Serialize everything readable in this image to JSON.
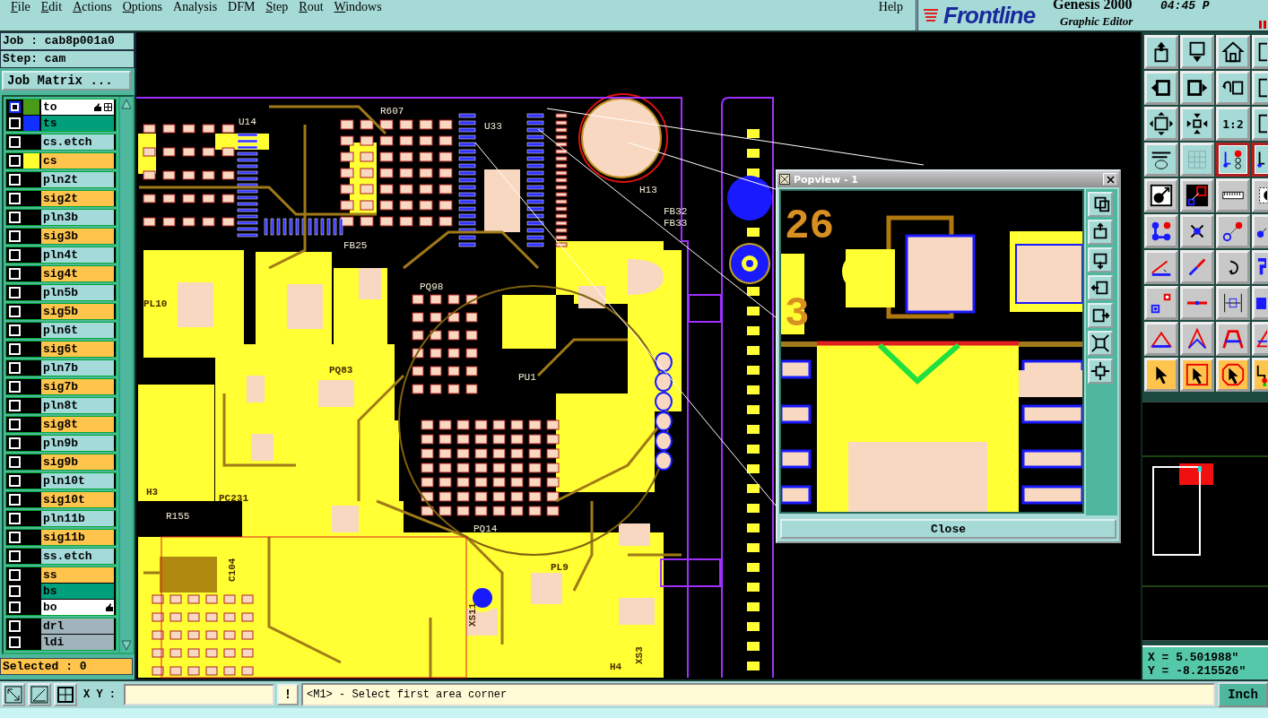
{
  "menu": {
    "items": [
      {
        "label": "File",
        "mnemonic": true
      },
      {
        "label": "Edit",
        "mnemonic": true
      },
      {
        "label": "Actions",
        "mnemonic": true
      },
      {
        "label": "Options",
        "mnemonic": true
      },
      {
        "label": "Analysis",
        "mnemonic": false
      },
      {
        "label": "DFM",
        "mnemonic": false
      },
      {
        "label": "Step",
        "mnemonic": true
      },
      {
        "label": "Rout",
        "mnemonic": true
      },
      {
        "label": "Windows",
        "mnemonic": true
      }
    ],
    "help": "Help"
  },
  "brand": {
    "logo": "Frontline",
    "product": "Genesis 2000",
    "subtitle": "Graphic Editor",
    "time": "04:45 P"
  },
  "job": {
    "job": "Job : cab8p001a0",
    "step": "Step: cam",
    "matrix_button": "Job Matrix ..."
  },
  "layer_groups": [
    {
      "layers": [
        {
          "name": "to",
          "kind": "overlay",
          "color": "#4a9a18",
          "selected": true,
          "affected": true
        },
        {
          "name": "ts",
          "kind": "mask",
          "color": "#1030ff",
          "selected": false,
          "affected": false
        }
      ]
    },
    {
      "layers": [
        {
          "name": "cs.etch",
          "kind": "plane",
          "selected": false,
          "affected": false
        }
      ]
    },
    {
      "layers": [
        {
          "name": "cs",
          "kind": "signal",
          "color": "#ffff30",
          "selected": false,
          "affected": false
        }
      ]
    },
    {
      "layers": [
        {
          "name": "pln2t",
          "kind": "plane",
          "selected": false,
          "affected": false
        }
      ]
    },
    {
      "layers": [
        {
          "name": "sig2t",
          "kind": "signal",
          "selected": false,
          "affected": false
        }
      ]
    },
    {
      "layers": [
        {
          "name": "pln3b",
          "kind": "plane",
          "selected": false,
          "affected": false
        }
      ]
    },
    {
      "layers": [
        {
          "name": "sig3b",
          "kind": "signal",
          "selected": false,
          "affected": false
        }
      ]
    },
    {
      "layers": [
        {
          "name": "pln4t",
          "kind": "plane",
          "selected": false,
          "affected": false
        }
      ]
    },
    {
      "layers": [
        {
          "name": "sig4t",
          "kind": "signal",
          "selected": false,
          "affected": false
        }
      ]
    },
    {
      "layers": [
        {
          "name": "pln5b",
          "kind": "plane",
          "selected": false,
          "affected": false
        }
      ]
    },
    {
      "layers": [
        {
          "name": "sig5b",
          "kind": "signal",
          "selected": false,
          "affected": false
        }
      ]
    },
    {
      "layers": [
        {
          "name": "pln6t",
          "kind": "plane",
          "selected": false,
          "affected": false
        }
      ]
    },
    {
      "layers": [
        {
          "name": "sig6t",
          "kind": "signal",
          "selected": false,
          "affected": false
        }
      ]
    },
    {
      "layers": [
        {
          "name": "pln7b",
          "kind": "plane",
          "selected": false,
          "affected": false
        }
      ]
    },
    {
      "layers": [
        {
          "name": "sig7b",
          "kind": "signal",
          "selected": false,
          "affected": false
        }
      ]
    },
    {
      "layers": [
        {
          "name": "pln8t",
          "kind": "plane",
          "selected": false,
          "affected": false
        }
      ]
    },
    {
      "layers": [
        {
          "name": "sig8t",
          "kind": "signal",
          "selected": false,
          "affected": false
        }
      ]
    },
    {
      "layers": [
        {
          "name": "pln9b",
          "kind": "plane",
          "selected": false,
          "affected": false
        }
      ]
    },
    {
      "layers": [
        {
          "name": "sig9b",
          "kind": "signal",
          "selected": false,
          "affected": false
        }
      ]
    },
    {
      "layers": [
        {
          "name": "pln10t",
          "kind": "plane",
          "selected": false,
          "affected": false
        }
      ]
    },
    {
      "layers": [
        {
          "name": "sig10t",
          "kind": "signal",
          "selected": false,
          "affected": false
        }
      ]
    },
    {
      "layers": [
        {
          "name": "pln11b",
          "kind": "plane",
          "selected": false,
          "affected": false
        }
      ]
    },
    {
      "layers": [
        {
          "name": "sig11b",
          "kind": "signal",
          "selected": false,
          "affected": false
        }
      ]
    },
    {
      "layers": [
        {
          "name": "ss.etch",
          "kind": "plane",
          "selected": false,
          "affected": false
        }
      ]
    },
    {
      "layers": [
        {
          "name": "ss",
          "kind": "signal",
          "selected": false,
          "affected": false
        },
        {
          "name": "bs",
          "kind": "mask",
          "selected": false,
          "affected": false
        },
        {
          "name": "bo",
          "kind": "overlay",
          "selected": false,
          "affected": true
        }
      ]
    },
    {
      "layers": [
        {
          "name": "drl",
          "kind": "drill",
          "selected": false,
          "affected": false
        },
        {
          "name": "ldi",
          "kind": "drill",
          "selected": false,
          "affected": false
        }
      ]
    }
  ],
  "selected_count": "Selected : 0",
  "board_labels": [
    "U14",
    "R607",
    "U33",
    "H13",
    "FB32",
    "FB33",
    "FB25",
    "PL10",
    "PQ98",
    "PQ83",
    "PU1",
    "PC231",
    "H3",
    "R155",
    "C104",
    "PQ14",
    "PL9",
    "XS11",
    "H4",
    "XS3"
  ],
  "popview": {
    "title": "Popview - 1",
    "labels": [
      "26",
      "3"
    ],
    "close": "Close"
  },
  "toolbar": {
    "rows": [
      {
        "kind": "view",
        "buttons": [
          {
            "selected": false
          },
          {
            "selected": false
          },
          {
            "selected": false
          },
          {
            "selected": false
          }
        ]
      },
      {
        "kind": "view",
        "buttons": [
          {
            "selected": false
          },
          {
            "selected": false
          },
          {
            "selected": false
          },
          {
            "selected": false
          }
        ]
      },
      {
        "kind": "view",
        "buttons": [
          {
            "selected": false
          },
          {
            "selected": false
          },
          {
            "selected": false,
            "label": "1:2"
          },
          {
            "selected": false
          }
        ]
      },
      {
        "kind": "view",
        "buttons": [
          {
            "selected": false
          },
          {
            "selected": false
          },
          {
            "selected": true
          },
          {
            "selected": true
          }
        ]
      },
      {
        "kind": "measure",
        "buttons": [
          {
            "selected": false
          },
          {
            "selected": false
          },
          {
            "selected": false
          },
          {
            "selected": false
          }
        ]
      },
      {
        "kind": "edit",
        "buttons": [
          {
            "selected": false
          },
          {
            "selected": false
          },
          {
            "selected": false
          },
          {
            "selected": false
          }
        ]
      },
      {
        "kind": "edit",
        "buttons": [
          {
            "selected": false
          },
          {
            "selected": false
          },
          {
            "selected": false
          },
          {
            "selected": false
          }
        ]
      },
      {
        "kind": "edit",
        "buttons": [
          {
            "selected": false
          },
          {
            "selected": false
          },
          {
            "selected": false
          },
          {
            "selected": false
          }
        ]
      },
      {
        "kind": "edit",
        "buttons": [
          {
            "selected": false
          },
          {
            "selected": false
          },
          {
            "selected": false
          },
          {
            "selected": false
          }
        ]
      },
      {
        "kind": "select",
        "buttons": [
          {
            "selected": false
          },
          {
            "selected": false
          },
          {
            "selected": false
          },
          {
            "selected": false
          }
        ]
      }
    ]
  },
  "coordinates": [
    "X = 5.501988\"",
    "Y = -8.215526\""
  ],
  "status": {
    "xy_label": "X Y :",
    "alert": "!",
    "message": "<M1> - Select first area corner",
    "units": "Inch"
  }
}
